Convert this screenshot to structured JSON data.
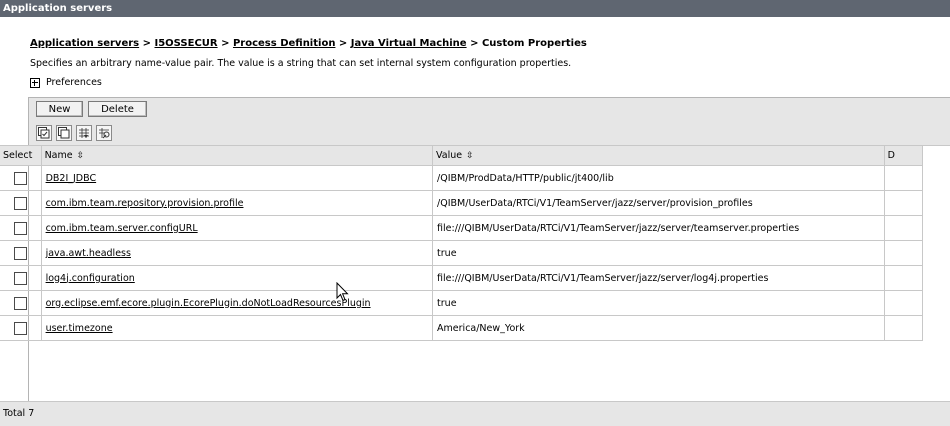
{
  "window": {
    "title": "Application servers"
  },
  "breadcrumb": {
    "items": [
      "Application servers",
      "I5OSSECUR",
      "Process Definition",
      "Java Virtual Machine"
    ],
    "separator": ">",
    "current": "Custom Properties"
  },
  "description": "Specifies an arbitrary name-value pair. The value is a string that can set internal system configuration properties.",
  "preferences_label": "Preferences",
  "toolbar": {
    "new_label": "New",
    "delete_label": "Delete"
  },
  "icon_toolbar": [
    "select-all-icon",
    "deselect-all-icon",
    "show-filter-icon",
    "clear-filter-icon"
  ],
  "table": {
    "columns": [
      "Select",
      "Name",
      "Value",
      "D"
    ],
    "sort_icon": "⇳",
    "rows": [
      {
        "name": "DB2I_JDBC",
        "value": "/QIBM/ProdData/HTTP/public/jt400/lib"
      },
      {
        "name": "com.ibm.team.repository.provision.profile",
        "value": "/QIBM/UserData/RTCi/V1/TeamServer/jazz/server/provision_profiles"
      },
      {
        "name": "com.ibm.team.server.configURL",
        "value": "file:///QIBM/UserData/RTCi/V1/TeamServer/jazz/server/teamserver.properties"
      },
      {
        "name": "java.awt.headless",
        "value": "true"
      },
      {
        "name": "log4j.configuration",
        "value": "file:///QIBM/UserData/RTCi/V1/TeamServer/jazz/server/log4j.properties"
      },
      {
        "name": "org.eclipse.emf.ecore.plugin.EcorePlugin.doNotLoadResourcesPlugin",
        "value": "true"
      },
      {
        "name": "user.timezone",
        "value": "America/New_York"
      }
    ]
  },
  "total": "Total 7",
  "colors": {
    "titlebar": "#5f6671",
    "toolbar_bg": "#e6e6e6",
    "border": "#c8c8c8"
  }
}
